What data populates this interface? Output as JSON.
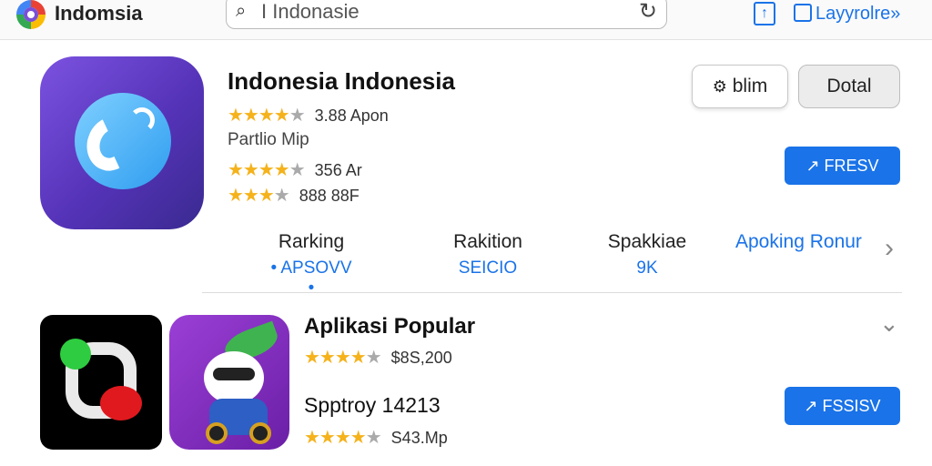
{
  "header": {
    "app_title": "Indomsia",
    "search_value": "I Indonasie",
    "top_link": "Layyrolre»"
  },
  "featured": {
    "name": "Indonesia Indonesia",
    "rating1": "3.88 Apon",
    "subtitle": "Partlio Mip",
    "rating2": "356 Ar",
    "rating3": "888 88F",
    "btn_ghost": "blim",
    "btn_gray": "Dotal",
    "btn_blue": "FRESV"
  },
  "stats": [
    {
      "label": "Rarking",
      "value": "• APSOVV •"
    },
    {
      "label": "Rakition",
      "value": "SEICIO"
    },
    {
      "label": "Spakkiae",
      "value": "9K"
    }
  ],
  "stats_link": "Apoking Ronur",
  "popular": {
    "title": "Aplikasi Popular",
    "rating1": "$8S,200",
    "app_name": "Spptroy 14213",
    "rating2": "S43.Mp",
    "btn_blue": "FSSISV"
  },
  "icons": {
    "search": "search-icon",
    "reload": "reload-icon",
    "share": "share-icon",
    "external": "external-link-icon",
    "chevron_right": "chevron-right-icon",
    "chevron_down": "chevron-down-icon"
  },
  "colors": {
    "accent": "#1a73e8",
    "star": "#f5b21b"
  }
}
